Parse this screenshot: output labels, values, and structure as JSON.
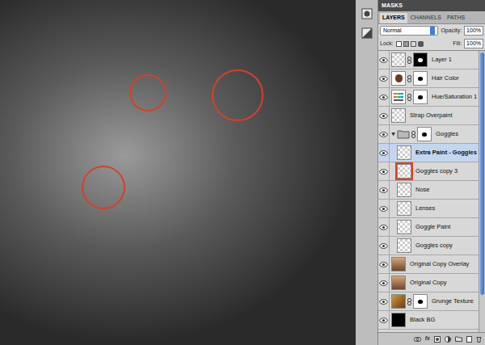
{
  "panel_header": "MASKS",
  "tabs": [
    {
      "label": "LAYERS",
      "selected": true
    },
    {
      "label": "CHANNELS",
      "selected": false
    },
    {
      "label": "PATHS",
      "selected": false
    }
  ],
  "blend_mode": "Normal",
  "opacity": {
    "label": "Opacity:",
    "value": "100%"
  },
  "lock": {
    "label": "Lock:"
  },
  "fill": {
    "label": "Fill:",
    "value": "100%"
  },
  "layers": [
    {
      "name": "Layer 1",
      "kind": "pixel",
      "visible": true,
      "selected": false,
      "in_group": false,
      "has_mask": true,
      "expanded": false,
      "highlighted": false
    },
    {
      "name": "Hair Color",
      "kind": "hair",
      "visible": true,
      "selected": false,
      "in_group": false,
      "has_mask": true,
      "expanded": false,
      "highlighted": false
    },
    {
      "name": "Hue/Saturation 1",
      "kind": "adjustment",
      "visible": true,
      "selected": false,
      "in_group": false,
      "has_mask": true,
      "expanded": false,
      "highlighted": false
    },
    {
      "name": "Strap Overpaint",
      "kind": "pixel",
      "visible": true,
      "selected": false,
      "in_group": false,
      "has_mask": false,
      "expanded": false,
      "highlighted": false
    },
    {
      "name": "Goggles",
      "kind": "group",
      "visible": true,
      "selected": false,
      "in_group": false,
      "has_mask": true,
      "expanded": true,
      "highlighted": false
    },
    {
      "name": "Extra Paint - Goggles",
      "kind": "pixel",
      "visible": true,
      "selected": true,
      "in_group": true,
      "has_mask": false,
      "expanded": false,
      "highlighted": false
    },
    {
      "name": "Goggles copy 3",
      "kind": "pixel",
      "visible": true,
      "selected": false,
      "in_group": true,
      "has_mask": false,
      "expanded": false,
      "highlighted": true
    },
    {
      "name": "Nose",
      "kind": "pixel",
      "visible": true,
      "selected": false,
      "in_group": true,
      "has_mask": false,
      "expanded": false,
      "highlighted": false
    },
    {
      "name": "Lenses",
      "kind": "pixel",
      "visible": true,
      "selected": false,
      "in_group": true,
      "has_mask": false,
      "expanded": false,
      "highlighted": false
    },
    {
      "name": "Goggle Paint",
      "kind": "pixel",
      "visible": true,
      "selected": false,
      "in_group": true,
      "has_mask": false,
      "expanded": false,
      "highlighted": false
    },
    {
      "name": "Goggles copy",
      "kind": "pixel",
      "visible": true,
      "selected": false,
      "in_group": true,
      "has_mask": false,
      "expanded": false,
      "highlighted": false
    },
    {
      "name": "Original Copy Overlay",
      "kind": "photo",
      "visible": true,
      "selected": false,
      "in_group": false,
      "has_mask": false,
      "expanded": false,
      "highlighted": false
    },
    {
      "name": "Original Copy",
      "kind": "photo",
      "visible": true,
      "selected": false,
      "in_group": false,
      "has_mask": false,
      "expanded": false,
      "highlighted": false
    },
    {
      "name": "Grunge Texture",
      "kind": "texture",
      "visible": true,
      "selected": false,
      "in_group": false,
      "has_mask": true,
      "expanded": false,
      "highlighted": false
    },
    {
      "name": "Black BG",
      "kind": "solid",
      "visible": true,
      "selected": false,
      "in_group": false,
      "has_mask": false,
      "expanded": false,
      "highlighted": false
    }
  ],
  "toolbar": {
    "fx": "fx"
  }
}
